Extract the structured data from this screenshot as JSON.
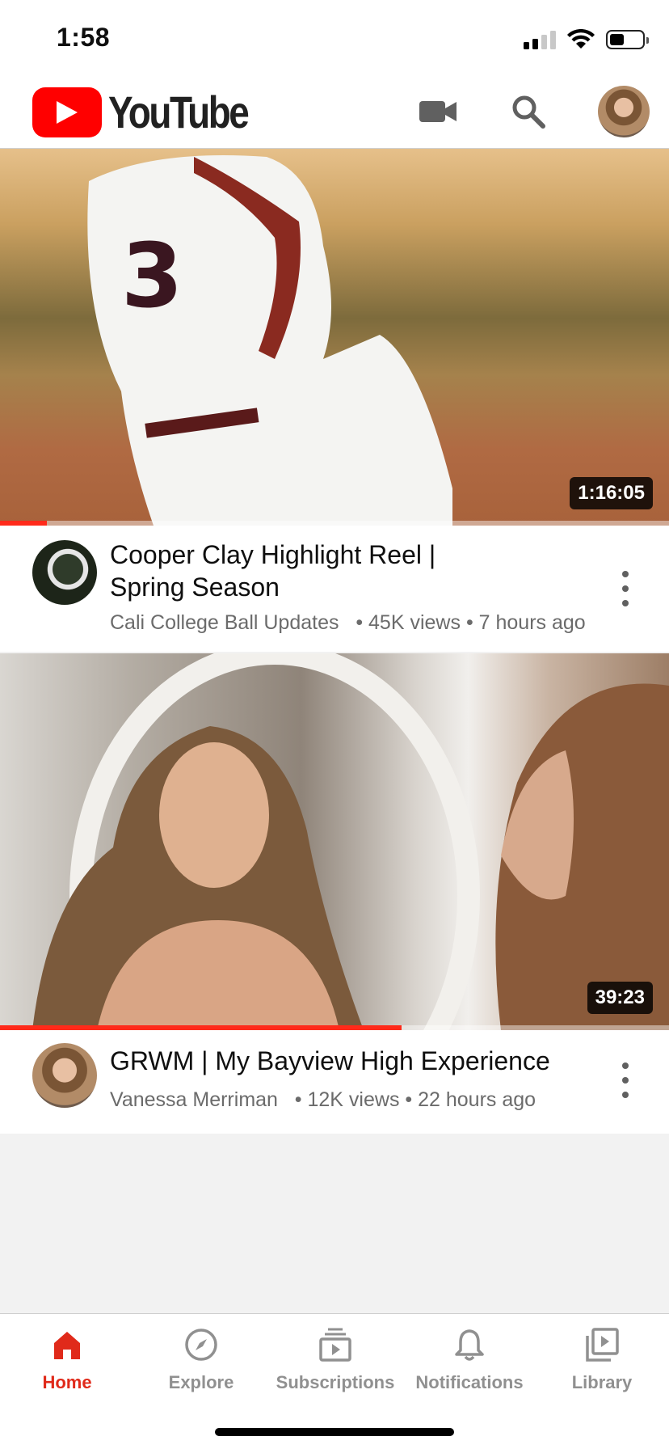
{
  "status_bar": {
    "time": "1:58"
  },
  "header": {
    "logo_text": "YouTube"
  },
  "videos": [
    {
      "title_line1": "Cooper Clay Highlight Reel |",
      "title_line2": "Spring Season",
      "channel": "Cali College Ball Updates",
      "views": "45K views",
      "age": "7 hours ago",
      "duration": "1:16:05",
      "watched_fraction": 0.07
    },
    {
      "title_line1": "GRWM | My Bayview High Experience",
      "channel": "Vanessa Merriman",
      "views": "12K views",
      "age": "22 hours ago",
      "duration": "39:23",
      "watched_fraction": 0.6
    }
  ],
  "bottom_nav": {
    "items": [
      {
        "label": "Home",
        "icon": "home-icon",
        "active": true
      },
      {
        "label": "Explore",
        "icon": "compass-icon"
      },
      {
        "label": "Subscriptions",
        "icon": "subscriptions-icon"
      },
      {
        "label": "Notifications",
        "icon": "bell-icon"
      },
      {
        "label": "Library",
        "icon": "library-icon"
      }
    ]
  },
  "colors": {
    "accent": "#ff0000",
    "active_nav": "#e02a1a",
    "progress": "#ff2a1a"
  }
}
